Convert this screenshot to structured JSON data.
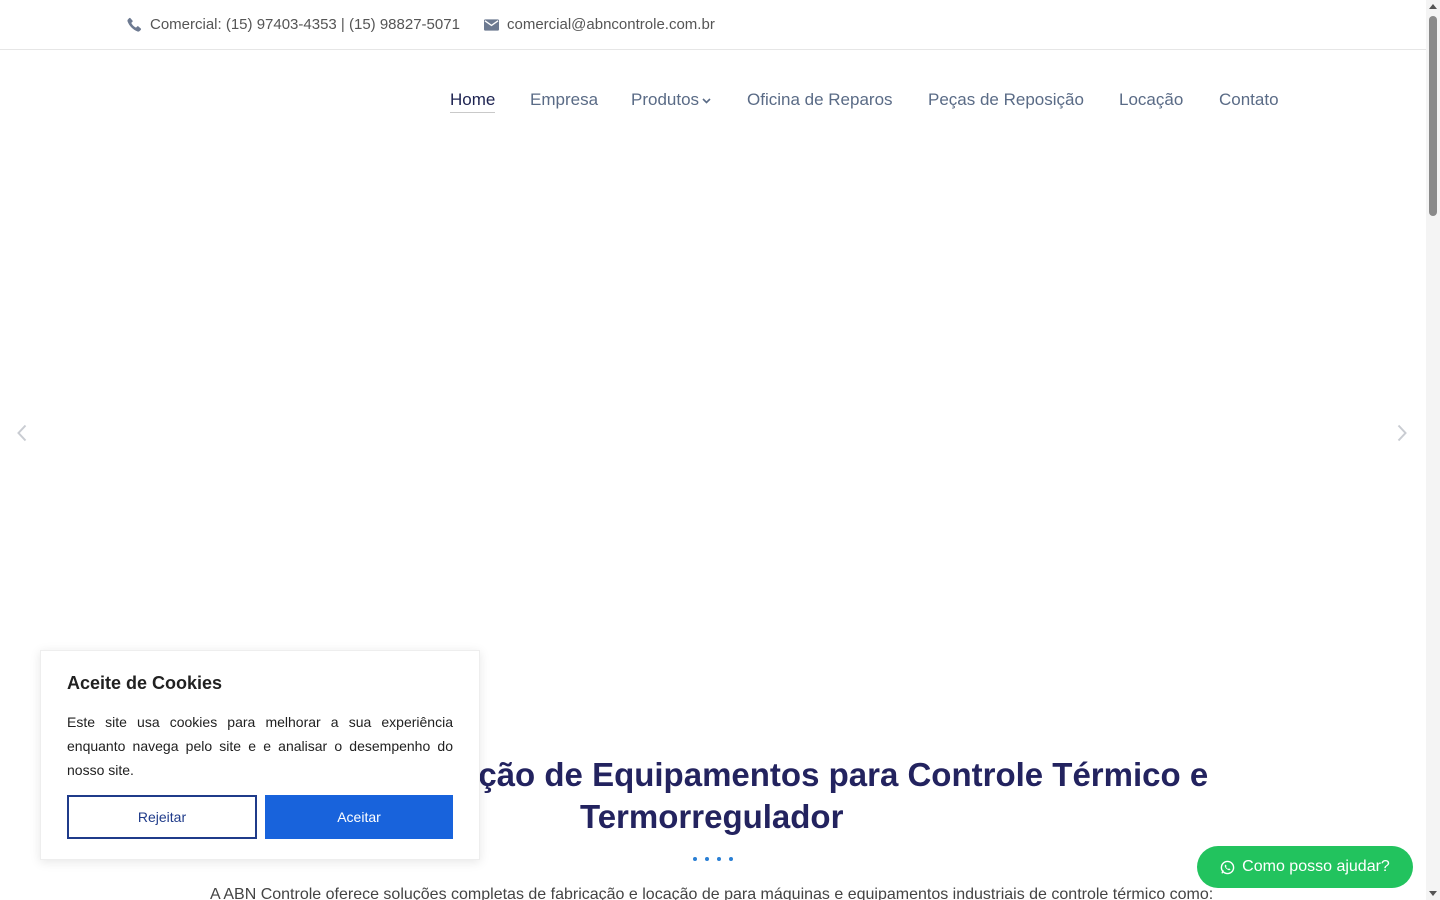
{
  "topbar": {
    "phone_text": "Comercial: (15) 97403-4353 | (15) 98827-5071",
    "phone_icon": "phone-icon",
    "email_text": "comercial@abncontrole.com.br",
    "email_icon": "envelope-icon"
  },
  "nav": {
    "items": [
      {
        "label": "Home"
      },
      {
        "label": "Empresa"
      },
      {
        "label": "Produtos"
      },
      {
        "label": "Oficina de Reparos"
      },
      {
        "label": "Peças de Reposição"
      },
      {
        "label": "Locação"
      },
      {
        "label": "Contato"
      }
    ],
    "active": "Home"
  },
  "hero": {
    "headline_line1": "ação de Equipamentos para Controle Térmico e",
    "headline_line2": "Termorregulador",
    "intro": "A ABN Controle oferece soluções completas de fabricação e locação de para máquinas e equipamentos industriais de controle térmico como:"
  },
  "cookie": {
    "title": "Aceite de Cookies",
    "text": "Este site usa cookies para melhorar a sua experiência enquanto navega pelo site e e analisar o desempenho do nosso site.",
    "reject_label": "Rejeitar",
    "accept_label": "Aceitar"
  },
  "whatsapp": {
    "label": "Como posso ajudar?",
    "icon": "whatsapp-icon"
  },
  "colors": {
    "nav_text": "#5a6b86",
    "nav_active": "#1d2351",
    "headline": "#23235f",
    "accept_button": "#1863dc",
    "reject_border": "#1f3b8a",
    "whatsapp": "#22c35e"
  }
}
